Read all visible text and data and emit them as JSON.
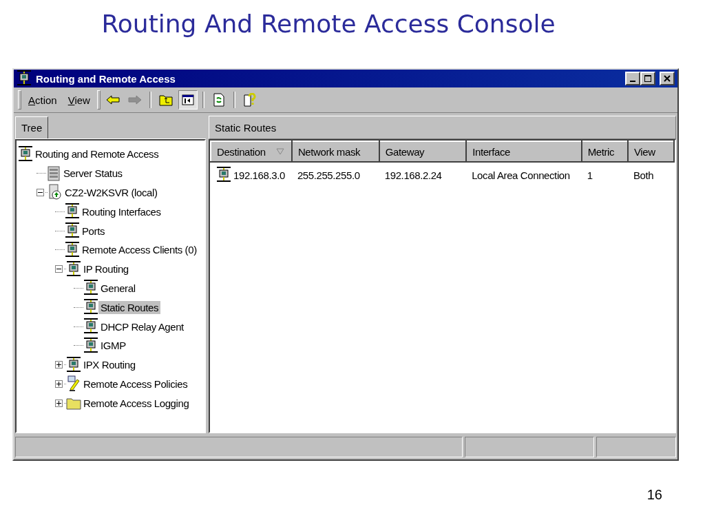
{
  "slide": {
    "title": "Routing And Remote Access Console",
    "page_number": "16"
  },
  "window": {
    "title": "Routing and Remote Access"
  },
  "menu": [
    {
      "label": "Action"
    },
    {
      "label": "View"
    }
  ],
  "toolbar": [
    {
      "kind": "back",
      "disabled": false,
      "pressed": false
    },
    {
      "kind": "forward",
      "disabled": true,
      "pressed": false
    },
    {
      "kind": "up",
      "disabled": false,
      "pressed": false
    },
    {
      "kind": "tree",
      "disabled": false,
      "pressed": true
    },
    {
      "kind": "refresh",
      "disabled": false,
      "pressed": false
    },
    {
      "kind": "help",
      "disabled": false,
      "pressed": false
    }
  ],
  "left_tab": {
    "label": "Tree"
  },
  "right_title": "Static Routes",
  "tree": [
    {
      "label": "Routing and Remote Access",
      "kind": "network",
      "selected": false,
      "children": [
        {
          "label": "Server Status",
          "kind": "server",
          "selected": false
        },
        {
          "label": "CZ2-W2KSVR (local)",
          "kind": "computer",
          "selected": false,
          "expanded": true,
          "children": [
            {
              "label": "Routing Interfaces",
              "kind": "network",
              "selected": false
            },
            {
              "label": "Ports",
              "kind": "network",
              "selected": false
            },
            {
              "label": "Remote Access Clients (0)",
              "kind": "network",
              "selected": false
            },
            {
              "label": "IP Routing",
              "kind": "network",
              "selected": false,
              "expanded": true,
              "children": [
                {
                  "label": "General",
                  "kind": "network",
                  "selected": false
                },
                {
                  "label": "Static Routes",
                  "kind": "network",
                  "selected": true
                },
                {
                  "label": "DHCP Relay Agent",
                  "kind": "network",
                  "selected": false
                },
                {
                  "label": "IGMP",
                  "kind": "network",
                  "selected": false
                }
              ]
            },
            {
              "label": "IPX Routing",
              "kind": "network",
              "selected": false,
              "expanded": false
            },
            {
              "label": "Remote Access Policies",
              "kind": "policy",
              "selected": false,
              "expanded": false
            },
            {
              "label": "Remote Access Logging",
              "kind": "folder",
              "selected": false,
              "expanded": false
            }
          ]
        }
      ]
    }
  ],
  "table": {
    "columns": [
      {
        "label": "Destination",
        "sorted": true
      },
      {
        "label": "Network mask",
        "sorted": false
      },
      {
        "label": "Gateway",
        "sorted": false
      },
      {
        "label": "Interface",
        "sorted": false
      },
      {
        "label": "Metric",
        "sorted": false
      },
      {
        "label": "View",
        "sorted": false
      }
    ],
    "rows": [
      {
        "cells": [
          "192.168.3.0",
          "255.255.255.0",
          "192.168.2.24",
          "Local Area Connection",
          "1",
          "Both"
        ]
      }
    ]
  }
}
